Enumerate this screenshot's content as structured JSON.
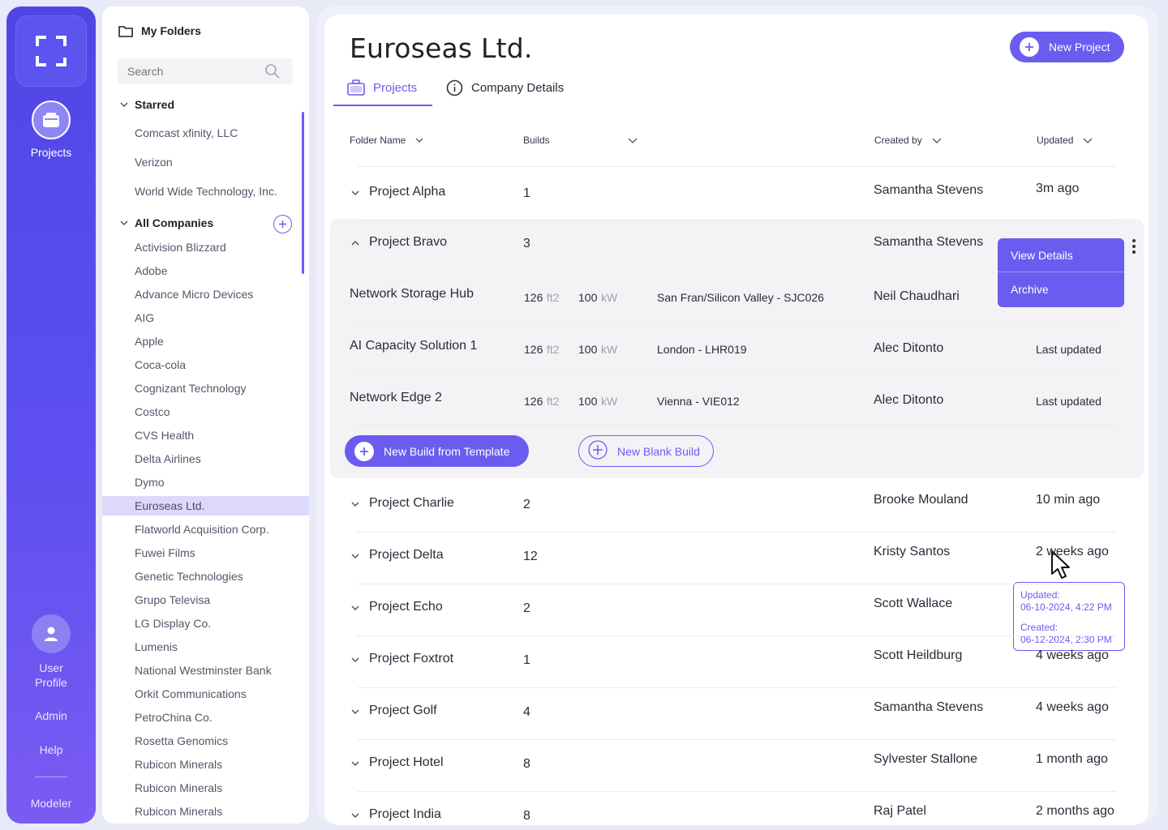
{
  "rail": {
    "projects_label": "Projects",
    "user_profile_line1": "User",
    "user_profile_line2": "Profile",
    "admin_label": "Admin",
    "help_label": "Help",
    "modeler_label": "Modeler"
  },
  "folders": {
    "header": "My Folders",
    "search_placeholder": "Search",
    "starred_label": "Starred",
    "starred": [
      "Comcast xfinity, LLC",
      "Verizon",
      "World Wide Technology, Inc."
    ],
    "all_label": "All Companies",
    "companies": [
      "Activision Blizzard",
      "Adobe",
      "Advance Micro Devices",
      "AIG",
      "Apple",
      "Coca-cola",
      "Cognizant Technology",
      "Costco",
      "CVS Health",
      "Delta Airlines",
      "Dymo",
      "Euroseas Ltd.",
      "Flatworld Acquisition Corp.",
      "Fuwei Films",
      "Genetic Technologies",
      "Grupo Televisa",
      "LG Display Co.",
      "Lumenis",
      "National Westminster Bank",
      "Orkit Communications",
      "PetroChina Co.",
      "Rosetta Genomics",
      "Rubicon Minerals",
      "Rubicon Minerals",
      "Rubicon Minerals"
    ],
    "active": "Euroseas Ltd."
  },
  "main": {
    "title": "Euroseas Ltd.",
    "new_project": "New Project",
    "tabs": [
      {
        "label": "Projects"
      },
      {
        "label": "Company Details"
      }
    ],
    "columns": {
      "folder": "Folder Name",
      "builds": "Builds",
      "created": "Created by",
      "updated": "Updated"
    },
    "projects": [
      {
        "name": "Project Alpha",
        "builds": "1",
        "created_by": "Samantha Stevens",
        "updated": "3m ago"
      },
      {
        "name": "Project Bravo",
        "builds": "3",
        "created_by": "Samantha Stevens",
        "updated": ""
      },
      {
        "name": "Project Charlie",
        "builds": "2",
        "created_by": "Brooke Mouland",
        "updated": "10 min ago"
      },
      {
        "name": "Project Delta",
        "builds": "12",
        "created_by": "Kristy Santos",
        "updated": "2 weeks ago"
      },
      {
        "name": "Project Echo",
        "builds": "2",
        "created_by": "Scott Wallace",
        "updated": ""
      },
      {
        "name": "Project Foxtrot",
        "builds": "1",
        "created_by": "Scott Heildburg",
        "updated": "4 weeks ago"
      },
      {
        "name": "Project Golf",
        "builds": "4",
        "created_by": "Samantha Stevens",
        "updated": "4 weeks ago"
      },
      {
        "name": "Project Hotel",
        "builds": "8",
        "created_by": "Sylvester Stallone",
        "updated": "1 month ago"
      },
      {
        "name": "Project India",
        "builds": "8",
        "created_by": "Raj Patel",
        "updated": "2 months ago"
      }
    ],
    "builds": [
      {
        "name": "Network Storage Hub",
        "area": "126",
        "area_unit": "ft2",
        "power": "100",
        "power_unit": "kW",
        "location": "San Fran/Silicon Valley - SJC026",
        "created_by": "Neil Chaudhari",
        "updated": ""
      },
      {
        "name": "AI Capacity Solution 1",
        "area": "126",
        "area_unit": "ft2",
        "power": "100",
        "power_unit": "kW",
        "location": "London - LHR019",
        "created_by": "Alec Ditonto",
        "updated": "Last updated"
      },
      {
        "name": "Network Edge 2",
        "area": "126",
        "area_unit": "ft2",
        "power": "100",
        "power_unit": "kW",
        "location": "Vienna - VIE012",
        "created_by": "Alec Ditonto",
        "updated": "Last updated"
      }
    ],
    "new_build_template": "New Build from Template",
    "new_blank_build": "New Blank Build",
    "menu": {
      "view_details": "View Details",
      "archive": "Archive"
    },
    "tooltip": {
      "updated_label": "Updated:",
      "updated_value": "06-10-2024, 4:22 PM",
      "created_label": "Created:",
      "created_value": "06-12-2024, 2:30 PM"
    }
  },
  "colors": {
    "accent": "#6b5cf0",
    "rail": "#4f46e5"
  }
}
